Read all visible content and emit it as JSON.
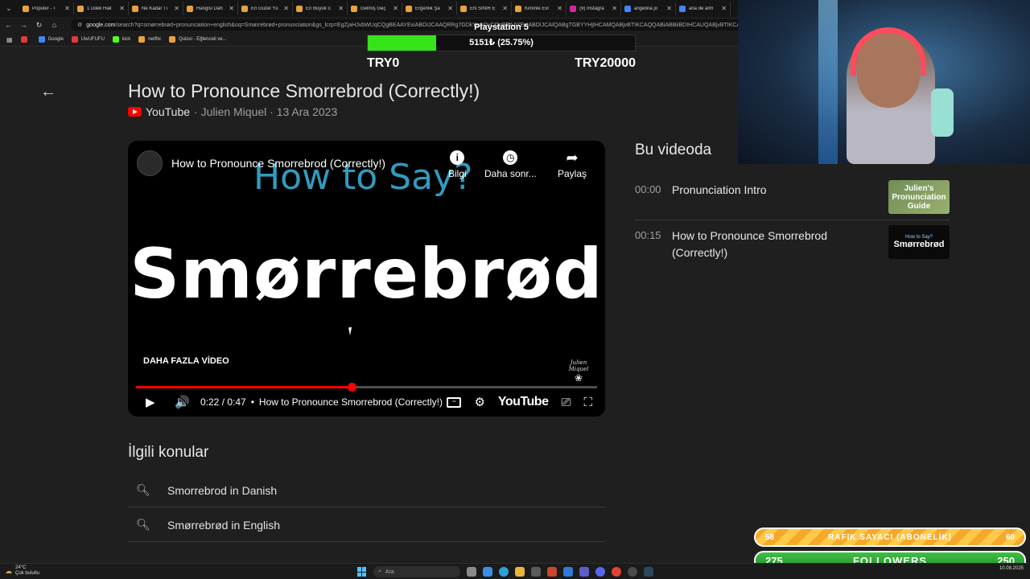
{
  "browser": {
    "tabs": [
      {
        "label": "Popüler - T",
        "color": "#e8a33a"
      },
      {
        "label": "1 Dilek Hak",
        "color": "#e8a33a"
      },
      {
        "label": "Ne Kadar Tı",
        "color": "#e8a33a"
      },
      {
        "label": "Hangisi Dah",
        "color": "#e8a33a"
      },
      {
        "label": "En Güzel Yü",
        "color": "#e8a33a"
      },
      {
        "label": "En Büyük o",
        "color": "#e8a33a"
      },
      {
        "label": "Gelmiş Geç",
        "color": "#e8a33a"
      },
      {
        "label": "Ergenlik Şa",
        "color": "#e8a33a"
      },
      {
        "label": "EN SİNİR E",
        "color": "#e8a33a"
      },
      {
        "label": "Kiminle Evl",
        "color": "#e8a33a"
      },
      {
        "label": "(9) Instagra",
        "color": "#d6249f"
      },
      {
        "label": "angelina jo",
        "color": "#4285f4"
      },
      {
        "label": "ana de arm",
        "color": "#4285f4"
      }
    ],
    "url_domain": "google.com",
    "url_rest": "/search?q=smørrebrød+pronunciation+english&oq=Smørrebrød+pronunciation&gs_lcrp=EgZjaHJvbWUqCQgBEAAYExiABDIJCAAQRRg7GDkYgAQyCQgBEAAYExiABDIJCAIQABgTGBYYHjIHCAMQABjvBTIKCAQQABiABBiiBDIHCAUQABjvBTIKCAYQABiiBBiJBQ",
    "bookmarks": [
      {
        "label": "",
        "color": "#e23b3b"
      },
      {
        "label": "Google",
        "color": "#4285f4"
      },
      {
        "label": "UwUFUFU",
        "color": "#e23b3b"
      },
      {
        "label": "kick",
        "color": "#53fc18"
      },
      {
        "label": "netflix",
        "color": "#e8a33a"
      },
      {
        "label": "Quizei - Eğlenceli ve...",
        "color": "#e8a33a"
      }
    ]
  },
  "donation_goal": {
    "title": "Playstation 5",
    "progress_text": "5151₺ (25.75%)",
    "progress_fraction": 0.2575,
    "min_label": "TRY0",
    "max_label": "TRY20000",
    "bar_color": "#37e31a"
  },
  "result": {
    "title": "How to Pronounce Smorrebrod (Correctly!)",
    "source_name": "YouTube",
    "source_meta": "· Julien Miquel · 13 Ara 2023"
  },
  "player": {
    "video_title": "How to Pronounce Smorrebrod (Correctly!)",
    "banner_text": "How to Say?",
    "big_word": "Smørrebrød",
    "info_label": "Bilgi",
    "later_label": "Daha sonr...",
    "share_label": "Paylaş",
    "more_videos": "DAHA FAZLA VİDEO",
    "watermark": "Julien Miquel",
    "time": "0:22 / 0:47",
    "dot": "•",
    "chapter_title": "How to Pronounce Smorrebrod (Correctly!)",
    "progress_fraction": 0.468,
    "buffer_fraction": 0.31,
    "youtube_logo_text": "YouTube"
  },
  "in_video": {
    "title": "Bu videoda",
    "chapters": [
      {
        "time": "00:00",
        "label": "Pronunciation Intro",
        "thumb_text": "Julien's Pronunciation Guide"
      },
      {
        "time": "00:15",
        "label": "How to Pronounce Smorrebrod (Correctly!)",
        "thumb_top": "How to Say?",
        "thumb_text": "Smørrebrød"
      }
    ]
  },
  "related": {
    "title": "İlgili konular",
    "items": [
      "Smorrebrod in Danish",
      "Smørrebrød in English"
    ]
  },
  "overlay_counters": {
    "subs": {
      "current": "58",
      "label": "RAFIK SAYACI (ABONELİK)",
      "goal": "60",
      "color": "#f6a928"
    },
    "followers": {
      "current": "275",
      "label": "FOLLOWERS",
      "goal": "250",
      "color": "#3fbf44"
    }
  },
  "taskbar": {
    "weather_temp": "24°C",
    "weather_desc": "Çok bulutlu",
    "search_placeholder": "Ara",
    "date": "10.08.2025"
  }
}
